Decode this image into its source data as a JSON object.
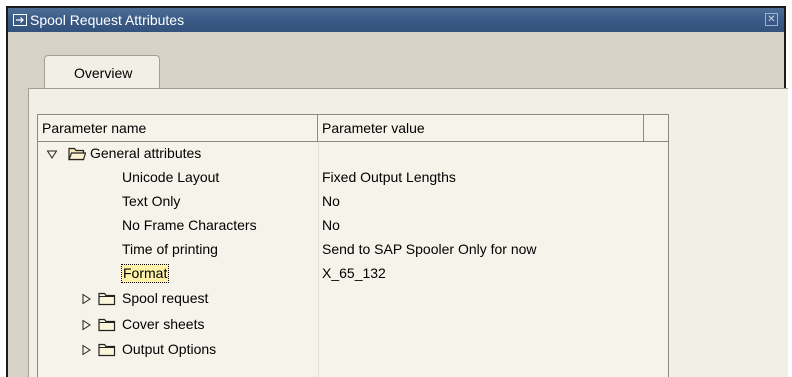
{
  "window": {
    "title": "Spool Request Attributes"
  },
  "tabs": [
    {
      "label": "Overview"
    }
  ],
  "table": {
    "columns": [
      "Parameter name",
      "Parameter value"
    ],
    "general": {
      "label": "General attributes",
      "rows": [
        {
          "name": "Unicode Layout",
          "value": "Fixed Output Lengths"
        },
        {
          "name": "Text Only",
          "value": "No"
        },
        {
          "name": "No Frame Characters",
          "value": "No"
        },
        {
          "name": "Time of printing",
          "value": "Send to SAP Spooler Only for now"
        },
        {
          "name": "Format",
          "value": "X_65_132"
        }
      ]
    },
    "folders": [
      {
        "label": "Spool request"
      },
      {
        "label": "Cover sheets"
      },
      {
        "label": "Output Options"
      }
    ]
  },
  "colors": {
    "titlebar": "#3a5b86",
    "background": "#d6d3c6",
    "panel": "#f1efe6",
    "focus_highlight": "#fff2a8"
  },
  "icons": [
    "window-icon",
    "close-icon",
    "expanded-icon",
    "collapsed-icon",
    "folder-open-icon",
    "folder-icon"
  ]
}
